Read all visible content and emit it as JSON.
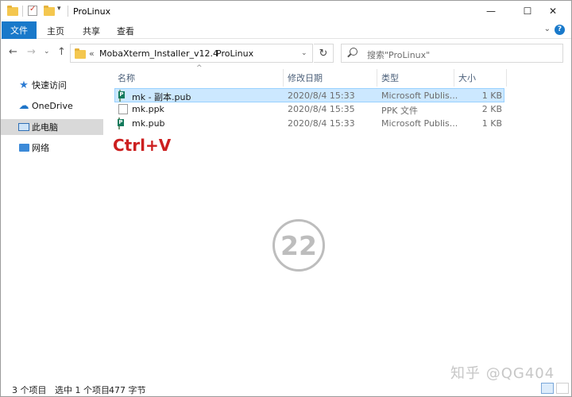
{
  "window": {
    "title": "ProLinux",
    "minimize_glyph": "—",
    "maximize_glyph": "☐",
    "close_glyph": "✕"
  },
  "ribbon": {
    "file_tab": "文件",
    "tabs": [
      "主页",
      "共享",
      "查看"
    ],
    "expand_glyph": "⌄",
    "help_glyph": "?"
  },
  "nav": {
    "back_glyph": "←",
    "forward_glyph": "→",
    "recent_glyph": "⌄",
    "up_glyph": "↑",
    "breadcrumb_overflow": "«",
    "breadcrumb": [
      "MobaXterm_Installer_v12.4",
      "ProLinux"
    ],
    "breadcrumb_sep": "›",
    "dropdown_glyph": "⌄",
    "refresh_glyph": "↻",
    "search_placeholder": "搜索\"ProLinux\""
  },
  "sidebar": {
    "items": [
      {
        "label": "快速访问",
        "icon": "star-icon"
      },
      {
        "label": "OneDrive",
        "icon": "cloud-icon"
      },
      {
        "label": "此电脑",
        "icon": "computer-icon",
        "selected": true
      },
      {
        "label": "网络",
        "icon": "network-icon"
      }
    ]
  },
  "columns": {
    "name": "名称",
    "date": "修改日期",
    "type": "类型",
    "size": "大小"
  },
  "files": [
    {
      "name": "mk - 副本.pub",
      "date": "2020/8/4 15:33",
      "type": "Microsoft Publis...",
      "size": "1 KB",
      "icon": "publisher-file-icon",
      "selected": true
    },
    {
      "name": "mk.ppk",
      "date": "2020/8/4 15:35",
      "type": "PPK 文件",
      "size": "2 KB",
      "icon": "blank-file-icon",
      "selected": false
    },
    {
      "name": "mk.pub",
      "date": "2020/8/4 15:33",
      "type": "Microsoft Publis...",
      "size": "1 KB",
      "icon": "publisher-file-icon",
      "selected": false
    }
  ],
  "annotation": {
    "shortcut": "Ctrl+V",
    "step": "22"
  },
  "watermark": "知乎 @QG404",
  "status": {
    "count": "3 个项目",
    "selected": "选中 1 个项目",
    "size": "477 字节"
  },
  "colors": {
    "accent": "#1979ca",
    "selection": "#cce8ff",
    "shortcut": "#cc1f1f"
  }
}
